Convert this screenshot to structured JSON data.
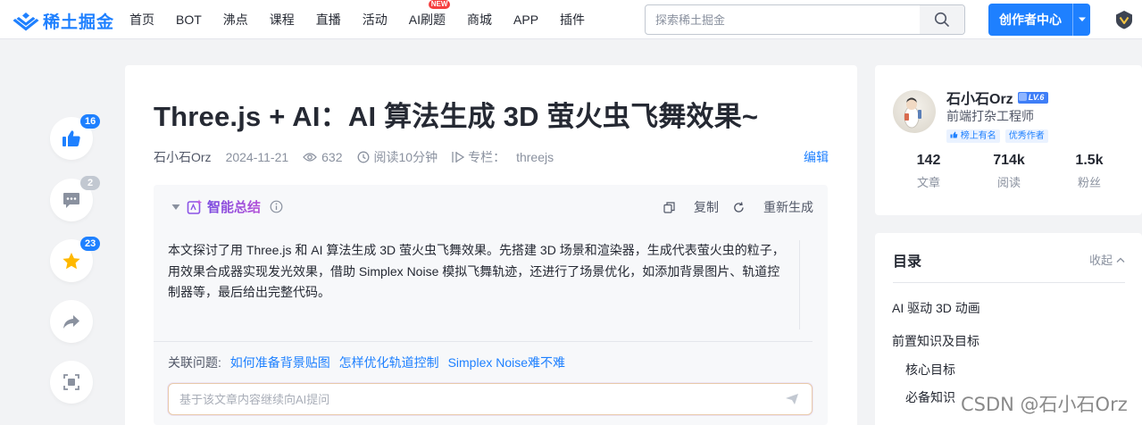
{
  "header": {
    "logo_text": "稀土掘金",
    "nav": [
      {
        "label": "首页"
      },
      {
        "label": "BOT"
      },
      {
        "label": "沸点"
      },
      {
        "label": "课程"
      },
      {
        "label": "直播"
      },
      {
        "label": "活动"
      },
      {
        "label": "AI刷题",
        "badge": "NEW"
      },
      {
        "label": "商城"
      },
      {
        "label": "APP"
      },
      {
        "label": "插件"
      }
    ],
    "search_placeholder": "探索稀土掘金",
    "create_button": "创作者中心",
    "colors": {
      "brand": "#1e80ff",
      "badge": "#f53f3f"
    }
  },
  "rail": {
    "like_count": "16",
    "comment_count": "2",
    "collect_count": "23"
  },
  "article": {
    "title": "Three.js + AI：AI 算法生成 3D 萤火虫飞舞效果~",
    "author": "石小石Orz",
    "date": "2024-11-21",
    "views": "632",
    "read_time": "阅读10分钟",
    "column_label": "专栏：",
    "column_name": "threejs",
    "edit": "编辑"
  },
  "summary": {
    "title": "智能总结",
    "copy": "复制",
    "regenerate": "重新生成",
    "body": "本文探讨了用 Three.js 和 AI 算法生成 3D 萤火虫飞舞效果。先搭建 3D 场景和渲染器，生成代表萤火虫的粒子，用效果合成器实现发光效果，借助 Simplex Noise 模拟飞舞轨迹，还进行了场景优化，如添加背景图片、轨道控制器等，最后给出完整代码。",
    "related_label": "关联问题:",
    "related": [
      "如何准备背景贴图",
      "怎样优化轨道控制",
      "Simplex Noise难不难"
    ],
    "ask_placeholder": "基于该文章内容继续向AI提问"
  },
  "author_card": {
    "name": "石小石Orz",
    "level": "LV.6",
    "job": "前端打杂工程师",
    "tags": [
      "榜上有名",
      "优秀作者"
    ],
    "stats": [
      {
        "num": "142",
        "label": "文章"
      },
      {
        "num": "714k",
        "label": "阅读"
      },
      {
        "num": "1.5k",
        "label": "粉丝"
      }
    ]
  },
  "toc": {
    "title": "目录",
    "collapse": "收起",
    "items": [
      {
        "label": "AI 驱动 3D 动画",
        "level": 1
      },
      {
        "label": "前置知识及目标",
        "level": 1
      },
      {
        "label": "核心目标",
        "level": 2
      },
      {
        "label": "必备知识",
        "level": 2
      }
    ]
  },
  "watermark": "CSDN @石小石Orz"
}
